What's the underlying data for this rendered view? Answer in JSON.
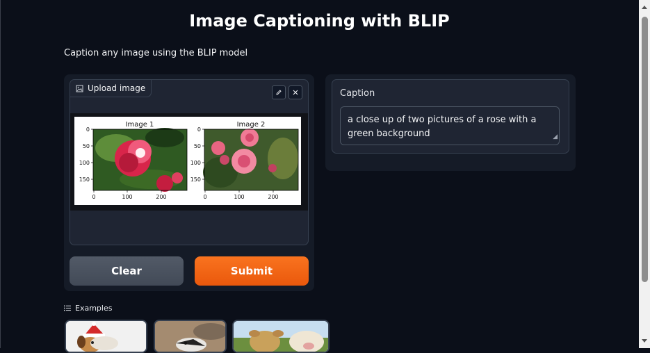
{
  "app": {
    "title": "Image Captioning with BLIP",
    "description": "Caption any image using the BLIP model"
  },
  "input": {
    "label": "Upload image",
    "label_icon": "image-icon",
    "edit_icon": "pencil-icon",
    "close_icon": "close-icon",
    "figure": {
      "subplots": [
        {
          "title": "Image 1",
          "yticks": [
            "0",
            "50",
            "100",
            "150"
          ],
          "xticks": [
            "0",
            "100",
            "200"
          ]
        },
        {
          "title": "Image 2",
          "yticks": [
            "0",
            "50",
            "100",
            "150"
          ],
          "xticks": [
            "0",
            "100",
            "200"
          ]
        }
      ]
    }
  },
  "buttons": {
    "clear": "Clear",
    "submit": "Submit"
  },
  "output": {
    "label": "Caption",
    "value": "a close up of two pictures of a rose with a green background"
  },
  "examples": {
    "label": "Examples",
    "icon": "list-icon"
  },
  "colors": {
    "background": "#0b0f19",
    "panel": "#151b27",
    "block": "#1f2533",
    "accent": "#ea580c",
    "secondary_button": "#4b5563"
  }
}
